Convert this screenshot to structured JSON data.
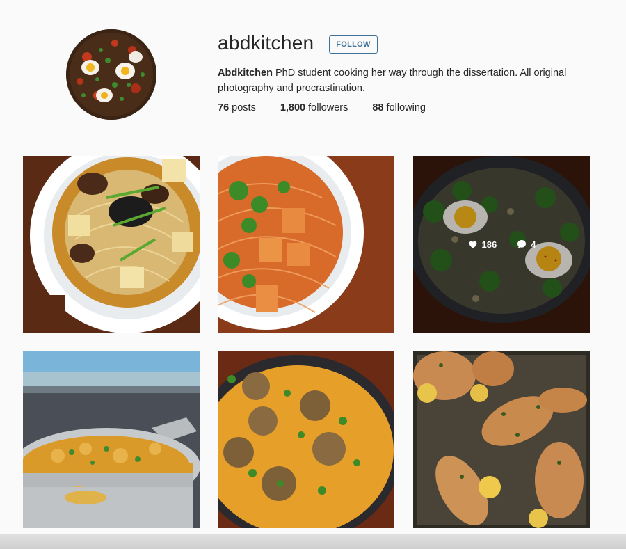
{
  "profile": {
    "username": "abdkitchen",
    "follow_label": "FOLLOW",
    "bio_name": "Abdkitchen",
    "bio_text": " PhD student cooking her way through the dissertation. All original photography and procrastination.",
    "stats": {
      "posts_count": "76",
      "posts_label": " posts",
      "followers_count": "1,800",
      "followers_label": " followers",
      "following_count": "88",
      "following_label": " following"
    }
  },
  "grid": {
    "hover_likes": "186",
    "hover_comments": "4"
  },
  "icons": [
    "heart-icon",
    "comment-icon"
  ],
  "colors": {
    "follow_accent": "#3f729b",
    "background": "#fafafa"
  }
}
